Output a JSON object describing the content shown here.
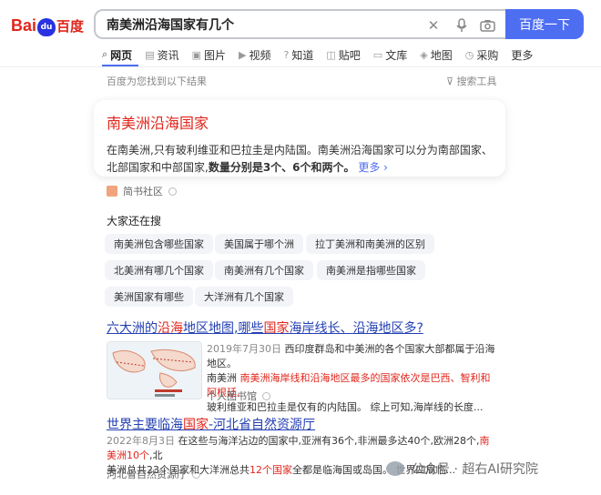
{
  "logo": {
    "bai": "Bai",
    "du": "du",
    "cn": "百度"
  },
  "search": {
    "query": "南美洲沿海国家有几个",
    "button": "百度一下"
  },
  "tabs": [
    {
      "icon": "search-icon",
      "label": "网页"
    },
    {
      "icon": "news-icon",
      "label": "资讯"
    },
    {
      "icon": "image-icon",
      "label": "图片"
    },
    {
      "icon": "video-icon",
      "label": "视频"
    },
    {
      "icon": "question-icon",
      "label": "知道"
    },
    {
      "icon": "forum-icon",
      "label": "贴吧"
    },
    {
      "icon": "doc-icon",
      "label": "文库"
    },
    {
      "icon": "map-icon",
      "label": "地图"
    },
    {
      "icon": "shop-icon",
      "label": "采购"
    },
    {
      "icon": "",
      "label": "更多"
    }
  ],
  "hint": "百度为您找到以下结果",
  "tools": "搜索工具",
  "answer": {
    "title": "南美洲沿海国家",
    "text_a": "在南美洲,只有玻利维亚和巴拉圭是内陆国。南美洲沿海国家可以分为南部国家、北部国家和中部国家,",
    "text_b": "数量分别是3个、6个和两个。",
    "more": "更多 ›",
    "source": "简书社区"
  },
  "related": {
    "title": "大家还在搜",
    "items": [
      "南美洲包含哪些国家",
      "美国属于哪个洲",
      "拉丁美洲和南美洲的区别",
      "北美洲有哪几个国家",
      "南美洲有几个国家",
      "南美洲是指哪些国家",
      "美洲国家有哪些",
      "大洋洲有几个国家"
    ]
  },
  "result1": {
    "title_a": "六大洲的",
    "title_b": "沿海",
    "title_c": "地区地图,哪些",
    "title_d": "国家",
    "title_e": "海岸线长、沿海地区多?",
    "date": "2019年7月30日",
    "line1": "西印度群岛和中美洲的各个国家大部都属于沿海地区。",
    "line2a": "南美洲",
    "line2b": "南美洲海岸线和沿海地区最多的国家依次是巴西、智利和阿根廷,",
    "line3": "玻利维亚和巴拉圭是仅有的内陆国。 综上可知,海岸线的长度...",
    "source": "个人图书馆"
  },
  "result2": {
    "title_a": "世界主要临海",
    "title_b": "国家",
    "title_c": "-河北省自然资源厅",
    "date": "2022年8月3日",
    "line1a": "在这些与海洋沾边的国家中,亚洲有36个,非洲最多达40个,欧洲28个,",
    "line1b": "南美洲10个",
    "line1c": ",北",
    "line2a": "美洲总共23个国家和大洋洲总共",
    "line2b": "12个国家",
    "line2c": "全都是临海国或岛国。",
    "line2d": "世界四周临...",
    "source": "河北省自然资源厅"
  },
  "watermark": "公众号 · 超右AI研究院"
}
